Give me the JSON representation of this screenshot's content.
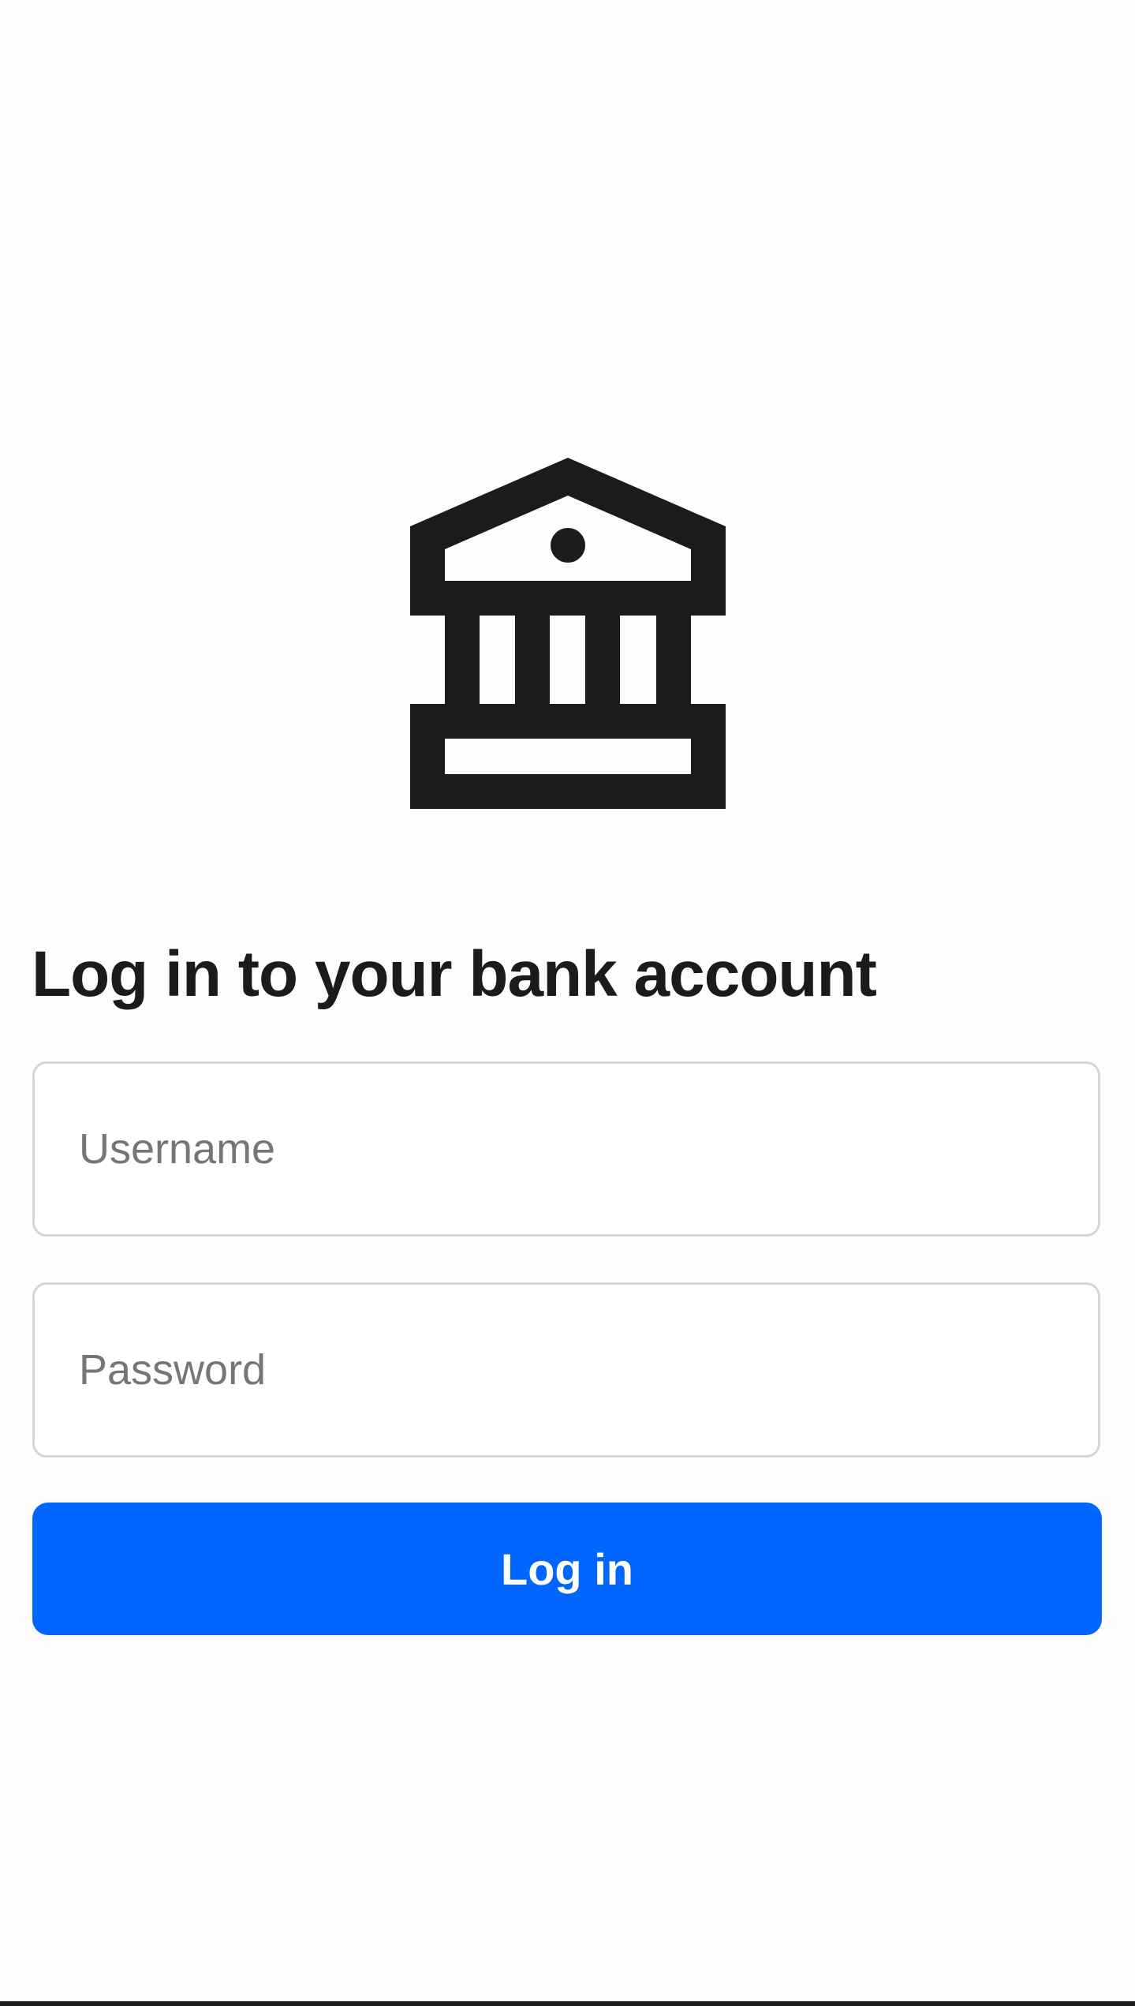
{
  "logo": {
    "icon": "bank-icon",
    "color": "#1b1b1b"
  },
  "login_form": {
    "title": "Log in to your bank account",
    "username": {
      "placeholder": "Username",
      "value": ""
    },
    "password": {
      "placeholder": "Password",
      "value": ""
    },
    "submit_label": "Log in"
  },
  "colors": {
    "accent": "#0066ff",
    "text": "#1b1b1b",
    "field_border": "#d6d6d6",
    "placeholder": "#767676"
  }
}
